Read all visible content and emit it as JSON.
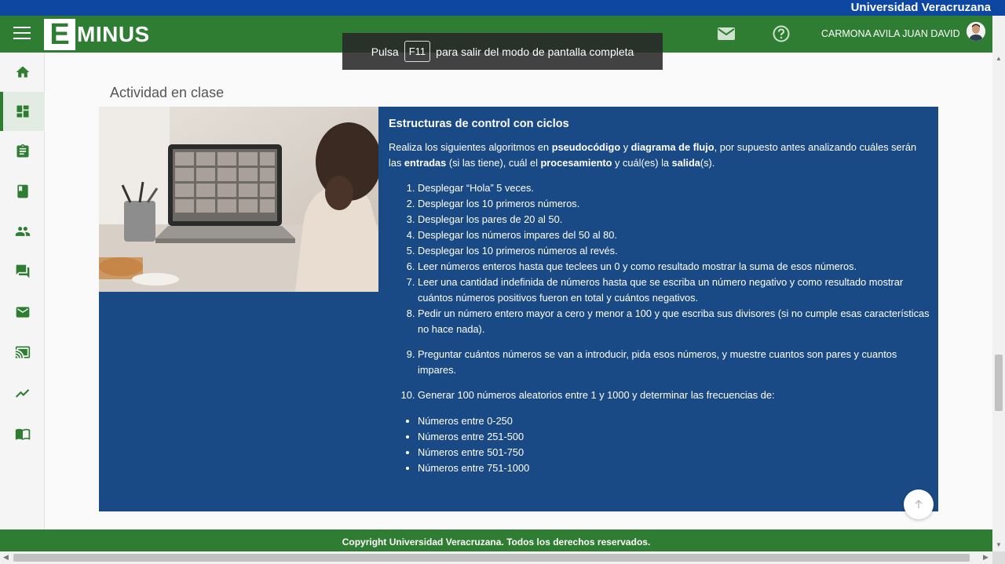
{
  "top_strip": {
    "university": "Universidad Veracruzana"
  },
  "header": {
    "logo_letter": "E",
    "logo_text": "MINUS",
    "user_name": "CARMONA AVILA JUAN DAVID"
  },
  "fullscreen_toast": {
    "before": "Pulsa",
    "key": "F11",
    "after": "para salir del modo de pantalla completa"
  },
  "sidebar": {
    "items": [
      {
        "icon": "home-icon"
      },
      {
        "icon": "dashboard-icon",
        "active": true
      },
      {
        "icon": "assignment-icon"
      },
      {
        "icon": "book-icon"
      },
      {
        "icon": "people-icon"
      },
      {
        "icon": "forum-icon"
      },
      {
        "icon": "mail-icon"
      },
      {
        "icon": "cast-icon"
      },
      {
        "icon": "trending-icon"
      },
      {
        "icon": "menu-book-icon"
      }
    ]
  },
  "main": {
    "section_title": "Actividad en clase",
    "card": {
      "title": "Estructuras de control con ciclos",
      "intro": {
        "t1": "Realiza los siguientes algoritmos en ",
        "b1": "pseudocódigo",
        "t2": " y ",
        "b2": "diagrama de flujo",
        "t3": ", por supuesto antes analizando cuáles serán las ",
        "b3": "entradas",
        "t4": " (si las tiene), cuál el ",
        "b4": "procesamiento",
        "t5": " y cuál(es) la ",
        "b5": "salida",
        "t6": "(s)."
      },
      "steps": [
        "Desplegar “Hola” 5 veces.",
        "Desplegar los 10 primeros números.",
        "Desplegar los pares de 20 al 50.",
        "Desplegar los números impares del 50 al 80.",
        "Desplegar los 10 primeros números al revés.",
        " Leer números enteros hasta que teclees un 0 y como resultado mostrar la suma de esos números.",
        "Leer una cantidad indefinida de números hasta que se escriba un número negativo y como resultado mostrar cuántos números positivos fueron en total y cuántos negativos.",
        "Pedir un número entero mayor a cero y menor a 100 y que escriba sus divisores (si no cumple esas características no hace nada).",
        "Preguntar cuántos números se van a introducir, pida esos números, y muestre cuantos son pares y cuantos impares.",
        "Generar 100 números aleatorios entre 1 y 1000 y determinar las frecuencias de:"
      ],
      "ranges": [
        "Números entre 0-250",
        "Números entre 251-500",
        "Números entre 501-750",
        "Números entre 751-1000"
      ]
    }
  },
  "footer": {
    "text": "Copyright Universidad Veracruzana. Todos los derechos reservados."
  },
  "colors": {
    "green": "#2e7d32",
    "blue_strip": "#0d47a1",
    "card_blue": "#1a4a85"
  }
}
